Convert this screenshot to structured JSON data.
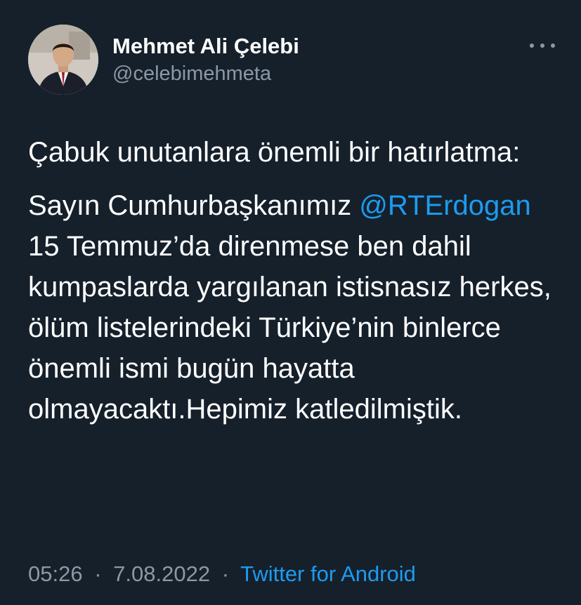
{
  "colors": {
    "background": "#15202b",
    "text_primary": "#ffffff",
    "text_secondary": "#8b98a5",
    "accent": "#1d9bf0"
  },
  "user": {
    "display_name": "Mehmet Ali Çelebi",
    "handle": "@celebimehmeta",
    "avatar_icon": "profile-photo"
  },
  "more_icon": "more-horizontal-icon",
  "tweet": {
    "paragraph_1": "Çabuk unutanlara önemli bir hatırlatma:",
    "paragraph_2_before_mention": "Sayın Cumhurbaşkanımız ",
    "mention": "@RTErdogan",
    "paragraph_2_after_mention": " 15 Temmuz’da direnmese ben dahil kumpaslarda yargılanan istisnasız herkes, ölüm listelerindeki Türkiye’nin binlerce önemli ismi bugün hayatta olmayacaktı.Hepimiz katledilmiştik."
  },
  "meta": {
    "time": "05:26",
    "date": "7.08.2022",
    "separator": "·",
    "source": "Twitter for Android"
  }
}
